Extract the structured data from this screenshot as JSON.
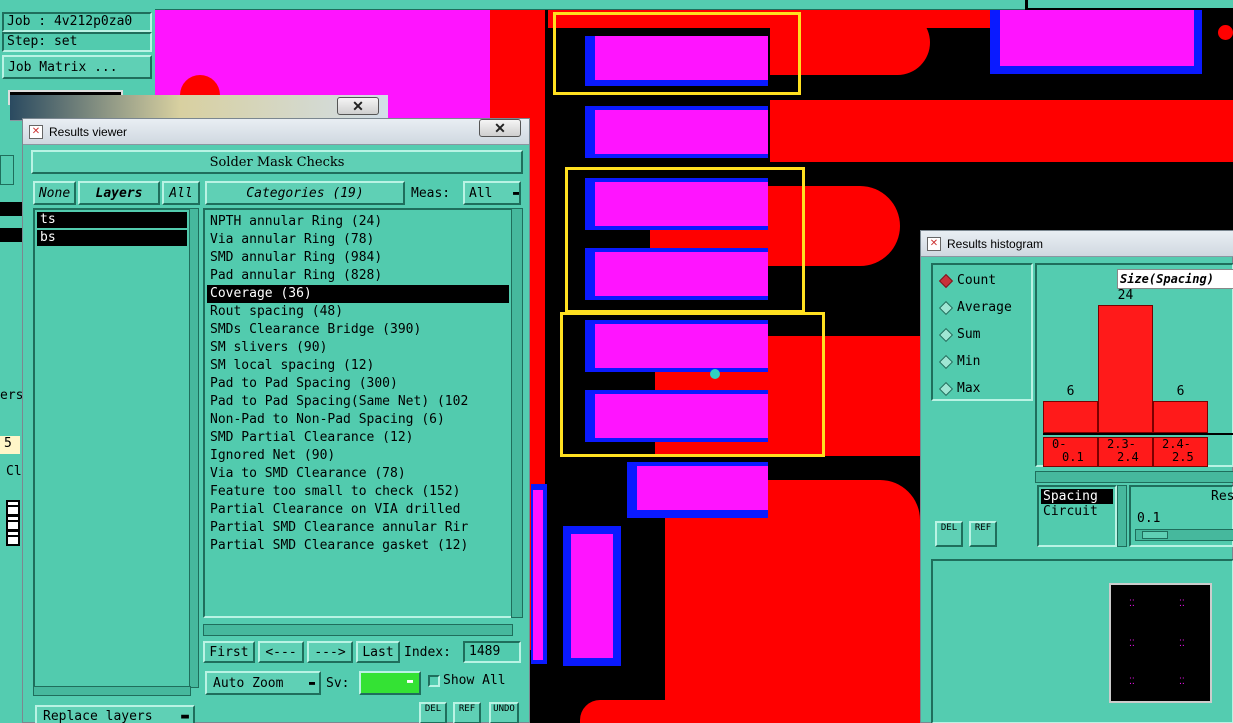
{
  "main": {
    "job": "Job : 4v212p0za0",
    "step": "Step: set",
    "job_matrix": "Job Matrix ...",
    "left_strip": [
      "ers",
      "5",
      "Cl"
    ],
    "replace_layers": "Replace layers"
  },
  "results_viewer": {
    "title": "Results viewer",
    "back_title": "Solder Mask Checks",
    "header": "Solder Mask Checks",
    "none": "None",
    "layers": "Layers",
    "all": "All",
    "categories_label": "Categories (19)",
    "meas_label": "Meas:",
    "meas_value": "All",
    "layer_items": [
      "ts",
      "bs"
    ],
    "categories": [
      "NPTH annular Ring (24)",
      "Via annular Ring (78)",
      "SMD annular Ring (984)",
      "Pad annular Ring (828)",
      "Coverage (36)",
      "Rout spacing (48)",
      "SMDs Clearance Bridge (390)",
      "SM slivers (90)",
      "SM local spacing (12)",
      "Pad to Pad Spacing (300)",
      "Pad to Pad Spacing(Same Net) (102",
      "Non-Pad to Non-Pad Spacing (6)",
      "SMD Partial Clearance (12)",
      "Ignored Net (90)",
      "Via to SMD Clearance (78)",
      "Feature too small to check (152)",
      "Partial Clearance on VIA drilled",
      "Partial SMD Clearance annular Rir",
      "Partial SMD Clearance gasket (12)"
    ],
    "selected_index": 4,
    "first": "First",
    "prev": "<---",
    "next": "--->",
    "last": "Last",
    "index_label": "Index:",
    "index_value": "1489",
    "auto_zoom": "Auto Zoom",
    "sv_label": "Sv:",
    "show_all": "Show All",
    "del": "DEL",
    "ref": "REF",
    "undo": "UNDO"
  },
  "histogram": {
    "title": "Results histogram",
    "modes": [
      "Count",
      "Average",
      "Sum",
      "Min",
      "Max"
    ],
    "selected_mode": "Count",
    "size_label": "Size(Spacing)",
    "del": "DEL",
    "ref": "REF",
    "list": [
      "Spacing",
      "Circuit"
    ],
    "res_label": "Res",
    "res_value": "0.1"
  },
  "chart_data": {
    "type": "bar",
    "categories": [
      "0-0.1",
      "2.3-2.4",
      "2.4-2.5"
    ],
    "category_lines": [
      [
        "0-",
        "0.1"
      ],
      [
        "2.3-",
        "2.4"
      ],
      [
        "2.4-",
        "2.5"
      ]
    ],
    "values": [
      6,
      24,
      6
    ],
    "title": "Size(Spacing)",
    "xlabel": "",
    "ylabel": "",
    "ylim": [
      0,
      24
    ],
    "bar_color": "#ff1a1a"
  },
  "colors": {
    "mask": "#ff14ff",
    "copper": "#ff0000",
    "outline": "#0a1aff",
    "highlight": "#ffe020",
    "panel": "#54ccb0"
  }
}
